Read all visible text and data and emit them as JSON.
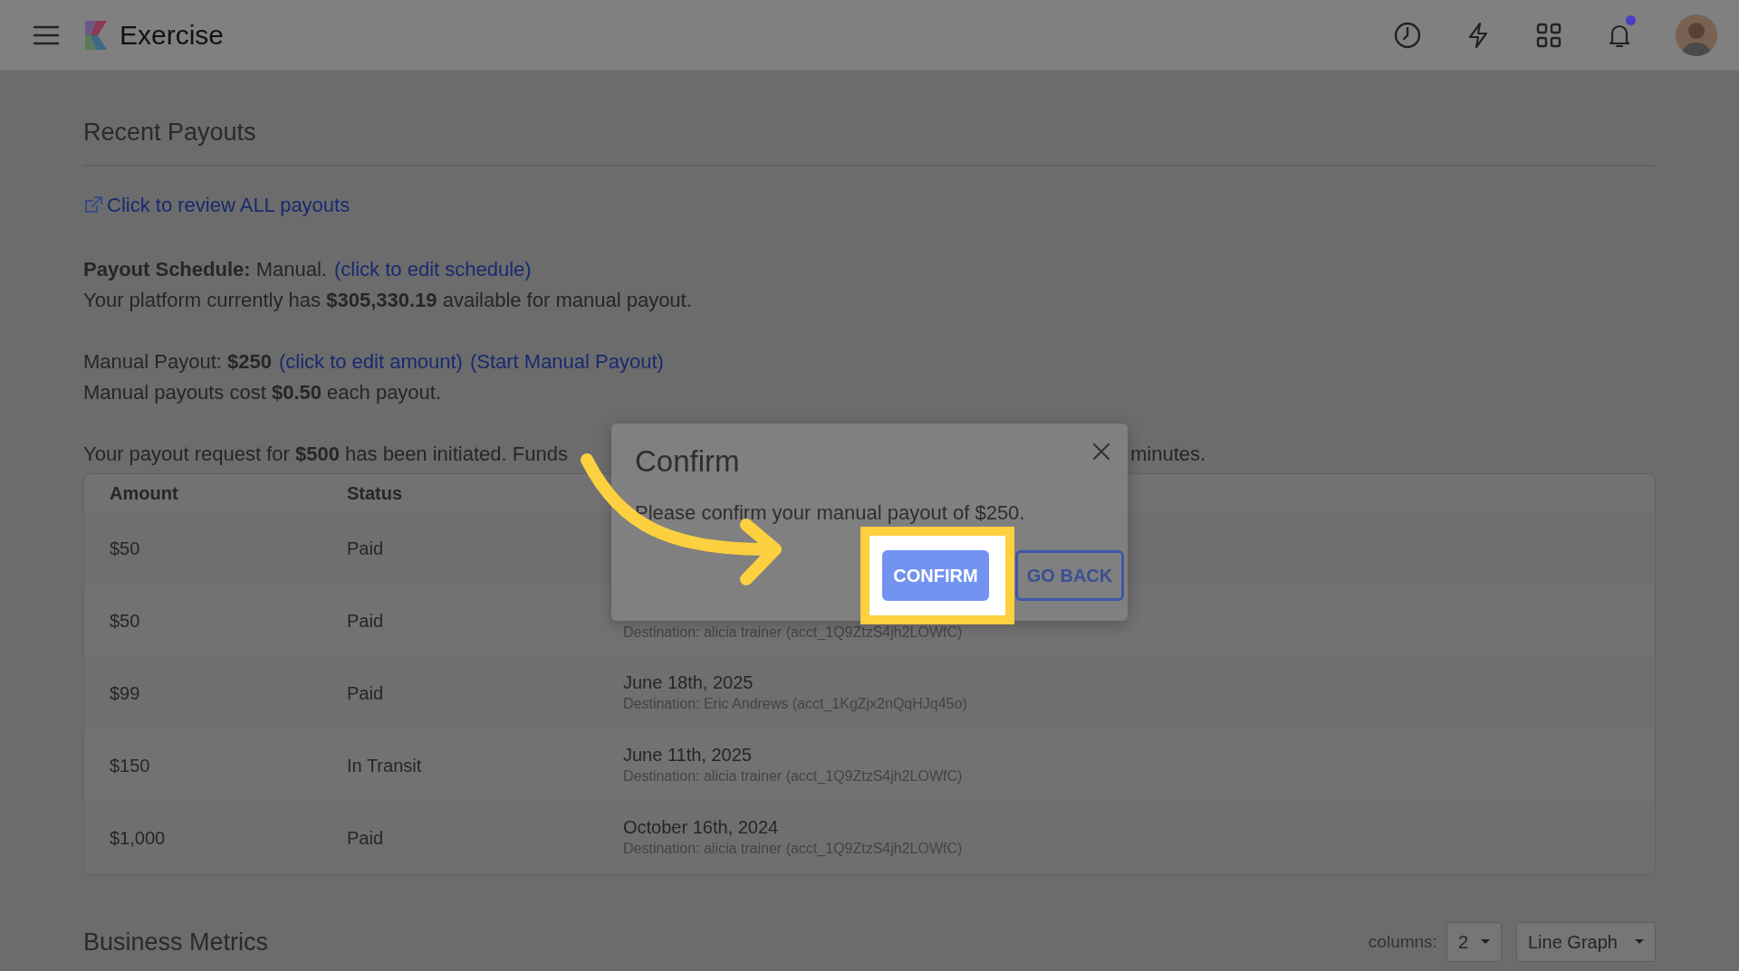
{
  "navbar": {
    "brand": "Exercise",
    "notifications_unread": true
  },
  "recent_payouts": {
    "title": "Recent Payouts",
    "review_link": "Click to review ALL payouts",
    "schedule_line": "**Payout Schedule:** Manual.",
    "schedule_link": "(click to edit schedule)",
    "available_line": "Your platform currently has **$305,330.19** available for manual payout.",
    "manual_line": "Manual Payout: **$250**",
    "edit_amount_link": "(click to edit amount)",
    "start_link": "(Start Manual Payout)",
    "cost_line": "Manual payouts cost **$0.50** each payout.",
    "request_line_start": "Your payout request for **$500** has been initiated. Funds",
    "request_line_end": "minutes."
  },
  "table": {
    "columns": [
      "Amount",
      "Status"
    ],
    "rows": [
      {
        "amount": "$50",
        "status": "Paid"
      },
      {
        "amount": "$50",
        "status": "Paid",
        "destination": "Destination: alicia trainer (acct_1Q9ZtzS4jh2LOWfC)"
      },
      {
        "amount": "$99",
        "status": "Paid",
        "date": "June 18th, 2025",
        "destination": "Destination: Eric Andrews (acct_1KgZjx2nQqHJq45o)"
      },
      {
        "amount": "$150",
        "status": "In Transit",
        "date": "June 11th, 2025",
        "destination": "Destination: alicia trainer (acct_1Q9ZtzS4jh2LOWfC)"
      },
      {
        "amount": "$1,000",
        "status": "Paid",
        "date": "October 16th, 2024",
        "destination": "Destination: alicia trainer (acct_1Q9ZtzS4jh2LOWfC)"
      }
    ]
  },
  "business_metrics": {
    "title": "Business Metrics",
    "columns_label": "columns:",
    "columns_value": "2",
    "graph_type": "Line Graph"
  },
  "modal": {
    "title": "Confirm",
    "message": "Please confirm your manual payout of $250.",
    "buttons": [
      {
        "label": "CONFIRM",
        "kind": "primary"
      },
      {
        "label": "GO BACK",
        "kind": "outline"
      }
    ]
  }
}
